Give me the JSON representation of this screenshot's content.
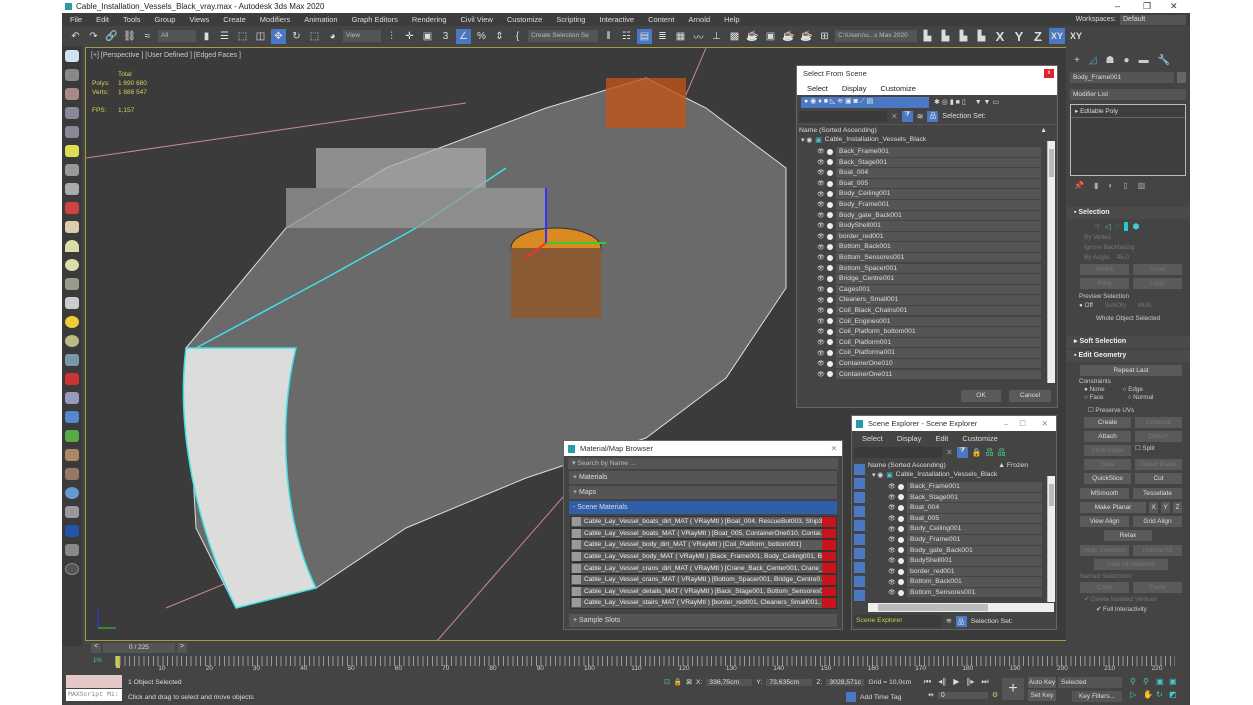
{
  "window": {
    "title": "Cable_Installation_Vessels_Black_vray.max - Autodesk 3ds Max 2020",
    "min": "–",
    "max": "❐",
    "close": "✕"
  },
  "menu": [
    "File",
    "Edit",
    "Tools",
    "Group",
    "Views",
    "Create",
    "Modifiers",
    "Animation",
    "Graph Editors",
    "Rendering",
    "Civil View",
    "Customize",
    "Scripting",
    "Interactive",
    "Content",
    "Arnold",
    "Help"
  ],
  "workspaces": {
    "label": "Workspaces:",
    "value": "Default"
  },
  "toolbar": {
    "filter": "All",
    "refcoord": "View",
    "selset": "Create Selection Se",
    "path": "C:\\Users\\u...s Max 2020",
    "axes": [
      "X",
      "Y",
      "Z",
      "XY",
      "XY"
    ]
  },
  "viewport": {
    "label": "[+] [Perspective ] [User Defined ] [Edged Faces ]",
    "stats": {
      "header": "Total",
      "polys_label": "Polys:",
      "polys": "1 690 680",
      "verts_label": "Verts:",
      "verts": "1 886 547",
      "fps_label": "FPS:",
      "fps": "1,157"
    }
  },
  "select_from_scene": {
    "title": "Select From Scene",
    "close": "x",
    "menu": [
      "Select",
      "Display",
      "Customize"
    ],
    "selection_set_label": "Selection Set:",
    "column": "Name (Sorted Ascending)",
    "root": "Cable_Installation_Vessels_Black",
    "items": [
      "Back_Frame001",
      "Back_Stage001",
      "Boat_004",
      "Boat_005",
      "Body_Ceiling001",
      "Body_Frame001",
      "Body_gate_Back001",
      "BodyShell001",
      "border_red001",
      "Bottom_Back001",
      "Bottom_Sensores001",
      "Bottom_Spacer001",
      "Bridge_Centre001",
      "Cages001",
      "Cleaners_Small001",
      "Coil_Black_Chains001",
      "Coil_Engines001",
      "Coil_Platform_bottom001",
      "Coil_Platform001",
      "Coil_Platforma001",
      "ContainerOne010",
      "ContainerOne011"
    ],
    "ok": "OK",
    "cancel": "Cancel"
  },
  "material_browser": {
    "title": "Material/Map Browser",
    "close": "✕",
    "search_placeholder": "Search by Name ...",
    "categories": [
      "+ Materials",
      "+ Maps"
    ],
    "scene_materials": "- Scene Materials",
    "sample_slots": "+ Sample Slots",
    "materials": [
      "Cable_Lay_Vessel_boats_dirt_MAT ( VRayMtl ) [Boat_004, RescueBot003, Ship3...",
      "Cable_Lay_Vessel_boats_MAT ( VRayMtl ) [Boat_005, ContainerOne010, Contai...",
      "Cable_Lay_Vessel_body_dirt_MAT ( VRayMtl ) [Coil_Platform_bottom001]",
      "Cable_Lay_Vessel_body_MAT ( VRayMtl ) [Back_Frame001, Body_Ceiling001, B...",
      "Cable_Lay_Vessel_crans_dirt_MAT ( VRayMtl ) [Crane_Back_Center001, Crane_...",
      "Cable_Lay_Vessel_crans_MAT ( VRayMtl ) [Bottom_Spacer001, Bridge_Centre0...",
      "Cable_Lay_Vessel_details_MAT ( VRayMtl ) [Back_Stage001, Bottom_Sensores0...",
      "Cable_Lay_Vessel_stairs_MAT ( VRayMtl ) [border_red001, Cleaners_Small001,..."
    ]
  },
  "scene_explorer": {
    "title": "Scene Explorer - Scene Explorer",
    "menu": [
      "Select",
      "Display",
      "Edit",
      "Customize"
    ],
    "column": "Name (Sorted Ascending)",
    "frozen": "▲ Frozen",
    "root": "Cable_Installation_Vessels_Black",
    "items": [
      "Back_Frame001",
      "Back_Stage001",
      "Boat_004",
      "Boat_005",
      "Body_Ceiling001",
      "Body_Frame001",
      "Body_gate_Back001",
      "BodyShell001",
      "border_red001",
      "Bottom_Back001",
      "Bottom_Sensores001"
    ],
    "footer_name": "Scene Explorer",
    "selection_set_label": "Selection Set:"
  },
  "command_panel": {
    "object_name": "Body_Frame001",
    "modifier_list": "Modifier List",
    "stack": [
      "Editable Poly"
    ],
    "selection": {
      "title": "Selection",
      "by_vertex": "By Vertex",
      "ignore_backfacing": "Ignore Backfacing",
      "by_angle": "By Angle:",
      "angle": "45,0",
      "shrink": "Shrink",
      "grow": "Grow",
      "ring": "Ring",
      "loop": "Loop",
      "preview": "Preview Selection",
      "off": "Off",
      "subobj": "SubObj",
      "multi": "Multi",
      "status": "Whole Object Selected"
    },
    "soft_selection": "Soft Selection",
    "edit_geometry": {
      "title": "Edit Geometry",
      "repeat_last": "Repeat Last",
      "constraints": "Constraints",
      "none": "None",
      "edge": "Edge",
      "face": "Face",
      "normal": "Normal",
      "preserve_uvs": "Preserve UVs",
      "create": "Create",
      "collapse": "Collapse",
      "attach": "Attach",
      "detach": "Detach",
      "slice_plane": "Slice Plane",
      "split": "Split",
      "slice": "Slice",
      "reset_plane": "Reset Plane",
      "quickslice": "QuickSlice",
      "cut": "Cut",
      "msmooth": "MSmooth",
      "tessellate": "Tessellate",
      "make_planar": "Make Planar",
      "x": "X",
      "y": "Y",
      "z": "Z",
      "view_align": "View Align",
      "grid_align": "Grid Align",
      "relax": "Relax",
      "hide_selected": "Hide Selected",
      "unhide_all": "Unhide All",
      "hide_unselected": "Hide Unselected",
      "named_selections": "Named Selections:",
      "copy": "Copy",
      "paste": "Paste",
      "delete_isolated": "Delete Isolated Vertices",
      "full_interactivity": "Full Interactivity"
    }
  },
  "timeline": {
    "frame": "0 / 225",
    "ticks": [
      "10",
      "20",
      "30",
      "40",
      "50",
      "60",
      "70",
      "80",
      "90",
      "100",
      "110",
      "120",
      "130",
      "140",
      "150",
      "160",
      "170",
      "180",
      "190",
      "200",
      "210",
      "220"
    ]
  },
  "status": {
    "selected": "1 Object Selected",
    "hint": "Click and drag to select and move objects",
    "maxscript": "MAXScript Mi:",
    "x_label": "X:",
    "x": "336,75cm",
    "y_label": "Y:",
    "y": "73,635cm",
    "z_label": "Z:",
    "z": "3028,571c",
    "grid": "Grid = 10,0cm",
    "add_time_tag": "Add Time Tag",
    "frame_value": "0",
    "auto_key": "Auto Key",
    "set_key": "Set Key",
    "key_mode": "Selected",
    "key_filters": "Key Filters..."
  }
}
